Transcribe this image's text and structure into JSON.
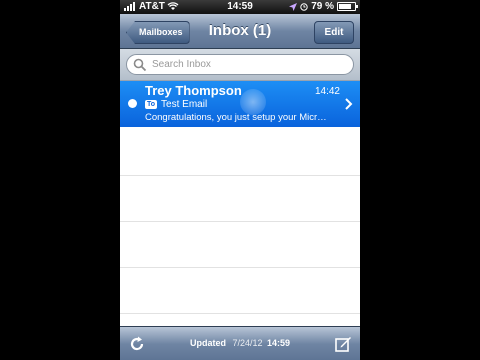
{
  "status_bar": {
    "carrier": "AT&T",
    "time": "14:59",
    "battery_percent": "79 %",
    "battery_level": 0.79,
    "icons": [
      "signal-bars-icon",
      "wifi-icon",
      "location-arrow-icon",
      "alarm-clock-icon",
      "battery-icon"
    ]
  },
  "nav": {
    "back_label": "Mailboxes",
    "title": "Inbox (1)",
    "edit_label": "Edit"
  },
  "search": {
    "placeholder": "Search Inbox"
  },
  "messages": [
    {
      "sender": "Trey Thompson",
      "time": "14:42",
      "badge": "To",
      "subject": "Test Email",
      "preview": "Congratulations, you just setup your Micr…",
      "unread": true,
      "selected": true
    }
  ],
  "toolbar": {
    "updated_label": "Updated",
    "updated_date": "7/24/12",
    "updated_time": "14:59",
    "icons": [
      "refresh-icon",
      "compose-icon"
    ]
  },
  "colors": {
    "selection": "#0a63dc",
    "navbar": "#6f85a3"
  }
}
